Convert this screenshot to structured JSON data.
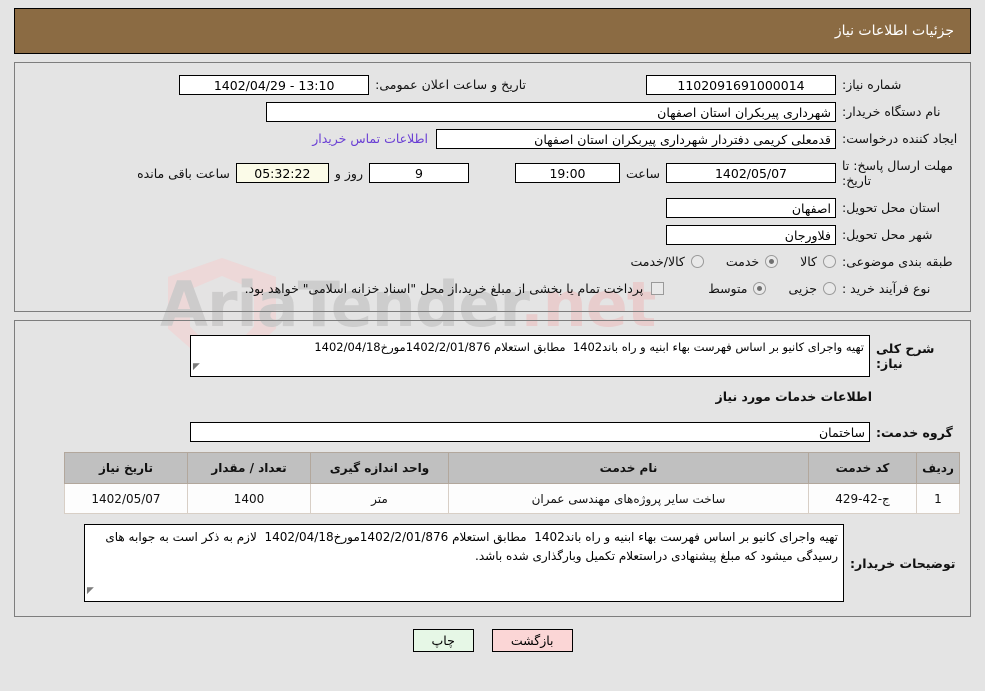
{
  "header": {
    "title": "جزئیات اطلاعات نیاز"
  },
  "watermark": {
    "text": "AriaTender",
    "suffix": ".net"
  },
  "form": {
    "need_number_label": "شماره نیاز:",
    "need_number_value": "1102091691000014",
    "public_announce_label": "تاریخ و ساعت اعلان عمومی:",
    "public_announce_value": "13:10 - 1402/04/29",
    "buyer_org_label": "نام دستگاه خریدار:",
    "buyer_org_value": "شهرداری پیربکران استان اصفهان",
    "creator_label": "ایجاد کننده درخواست:",
    "creator_value": "قدمعلی کریمی دفتردار شهرداری پیربکران استان اصفهان",
    "contact_link": "اطلاعات تماس خریدار",
    "deadline_label": "مهلت ارسال پاسخ: تا تاریخ:",
    "deadline_date": "1402/05/07",
    "hour_label": "ساعت",
    "deadline_time": "19:00",
    "days_value": "9",
    "days_label": "روز و",
    "countdown_value": "05:32:22",
    "remaining_label": "ساعت باقی مانده",
    "province_label": "استان محل تحویل:",
    "province_value": "اصفهان",
    "city_label": "شهر محل تحویل:",
    "city_value": "فلاورجان",
    "category_label": "طبقه بندی موضوعی:",
    "category_options": [
      {
        "label": "کالا",
        "selected": false
      },
      {
        "label": "خدمت",
        "selected": true
      },
      {
        "label": "کالا/خدمت",
        "selected": false
      }
    ],
    "process_label": "نوع فرآیند خرید :",
    "process_options": [
      {
        "label": "جزیی",
        "selected": false
      },
      {
        "label": "متوسط",
        "selected": true
      }
    ],
    "treasury_checkbox_checked": false,
    "treasury_text": "پرداخت تمام یا بخشی از مبلغ خرید،از محل \"اسناد خزانه اسلامی\" خواهد بود."
  },
  "description": {
    "label": "شرح کلی نیاز:",
    "value": "تهیه واجرای کانیو بر اساس فهرست بهاء ابنیه و راه باند1402  مطابق استعلام 1402/2/01/876مورخ1402/04/18"
  },
  "services_section": {
    "heading": "اطلاعات خدمات مورد نیاز",
    "group_label": "گروه خدمت:",
    "group_value": "ساختمان"
  },
  "table": {
    "columns": [
      "ردیف",
      "کد خدمت",
      "نام خدمت",
      "واحد اندازه گیری",
      "تعداد / مقدار",
      "تاریخ نیاز"
    ],
    "rows": [
      {
        "row_no": "1",
        "service_code": "ج-42-429",
        "service_name": "ساخت سایر پروژه‌های مهندسی عمران",
        "unit": "متر",
        "quantity": "1400",
        "need_date": "1402/05/07"
      }
    ]
  },
  "notes": {
    "label": "توضیحات خریدار:",
    "value": "تهیه واجرای کانیو بر اساس فهرست بهاء ابنیه و راه باند1402  مطابق استعلام 1402/2/01/876مورخ1402/04/18  لازم به ذکر است به جوابه های رسیدگی میشود که مبلغ پیشنهادی دراستعلام تکمیل وبارگذاری شده باشد."
  },
  "buttons": {
    "print": "چاپ",
    "back": "بازگشت"
  },
  "colors": {
    "header_bg": "#8b6b43",
    "link": "#6a3fd4",
    "print_btn_bg": "#e6f7e6",
    "back_btn_bg": "#fbd6d6",
    "table_header_bg": "#c0c0c0",
    "countdown_bg": "#fbfbe8"
  }
}
